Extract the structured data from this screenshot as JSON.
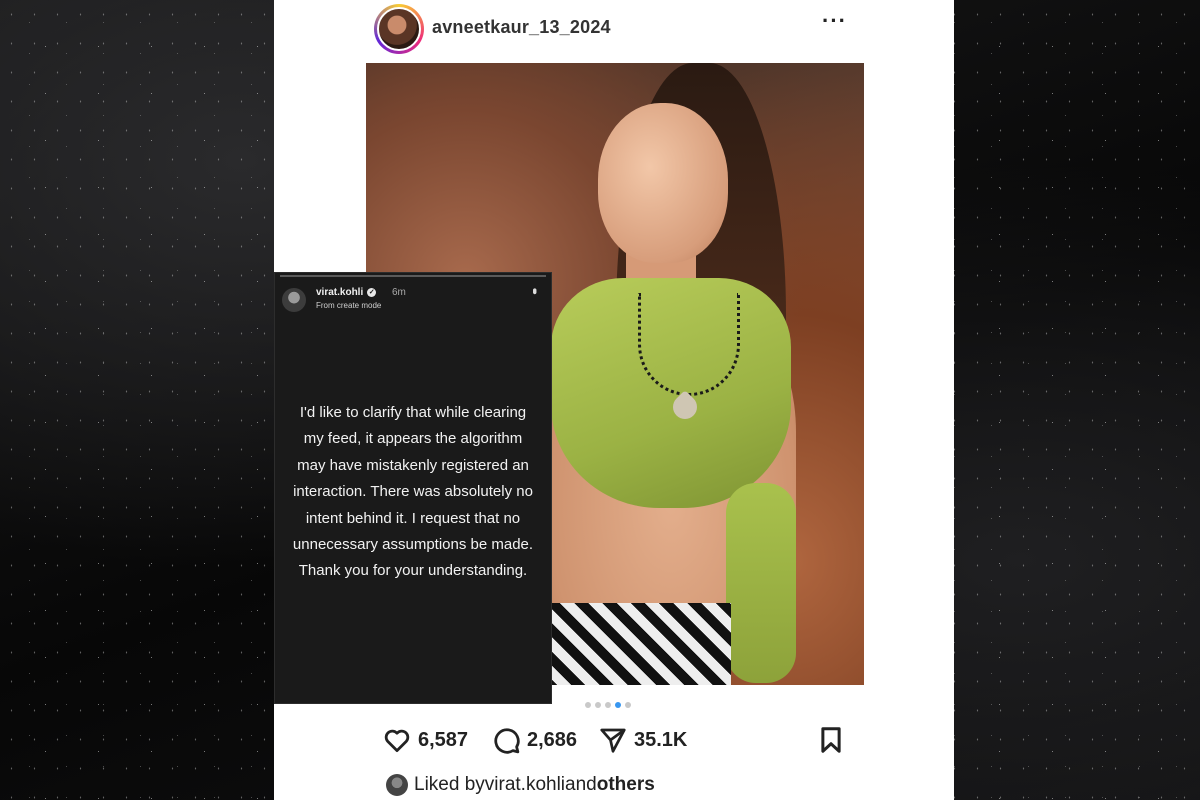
{
  "post": {
    "username": "avneetkaur_13_2024",
    "more_label": "···",
    "carousel": {
      "count": 5,
      "active_index": 3
    },
    "likes": "6,587",
    "comments": "2,686",
    "shares": "35.1K",
    "liked_prefix": "Liked by ",
    "liked_user": "virat.kohli",
    "liked_middle": " and ",
    "liked_suffix": "others"
  },
  "story": {
    "username": "virat.kohli",
    "time": "6m",
    "subtitle": "From create mode",
    "text": "I'd like to clarify that while clearing my feed, it appears the algorithm may have mistakenly registered an interaction. There was absolutely no intent behind it. I request that no unnecessary assumptions be made. Thank you for your understanding."
  },
  "colors": {
    "accent_dot": "#3897f0",
    "story_bg": "#1a1a1a",
    "post_bg": "#ffffff"
  },
  "icons": [
    "heart-icon",
    "comment-icon",
    "share-icon",
    "bookmark-icon",
    "more-options-icon",
    "verified-icon"
  ]
}
